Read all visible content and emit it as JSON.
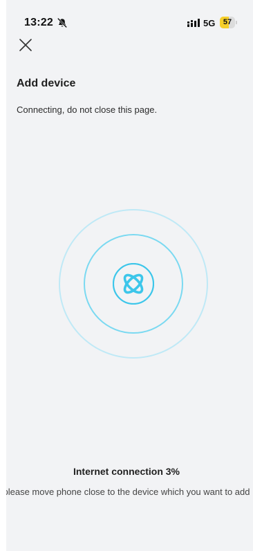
{
  "status_bar": {
    "time": "13:22",
    "network": "5G",
    "battery_percent": "57",
    "battery_level": 0.57,
    "bell_icon": "bell-slash-icon",
    "signal_icon": "signal-bars-icon"
  },
  "header": {
    "close_icon": "close-icon",
    "title": "Add device",
    "subtitle": "Connecting, do not close this page."
  },
  "animation": {
    "center_icon": "atom-icon",
    "accent_color": "#3cc6ea"
  },
  "progress": {
    "title": "Internet connection 3%",
    "percent": 3,
    "hint": "please move phone close to the device which you want to add"
  }
}
